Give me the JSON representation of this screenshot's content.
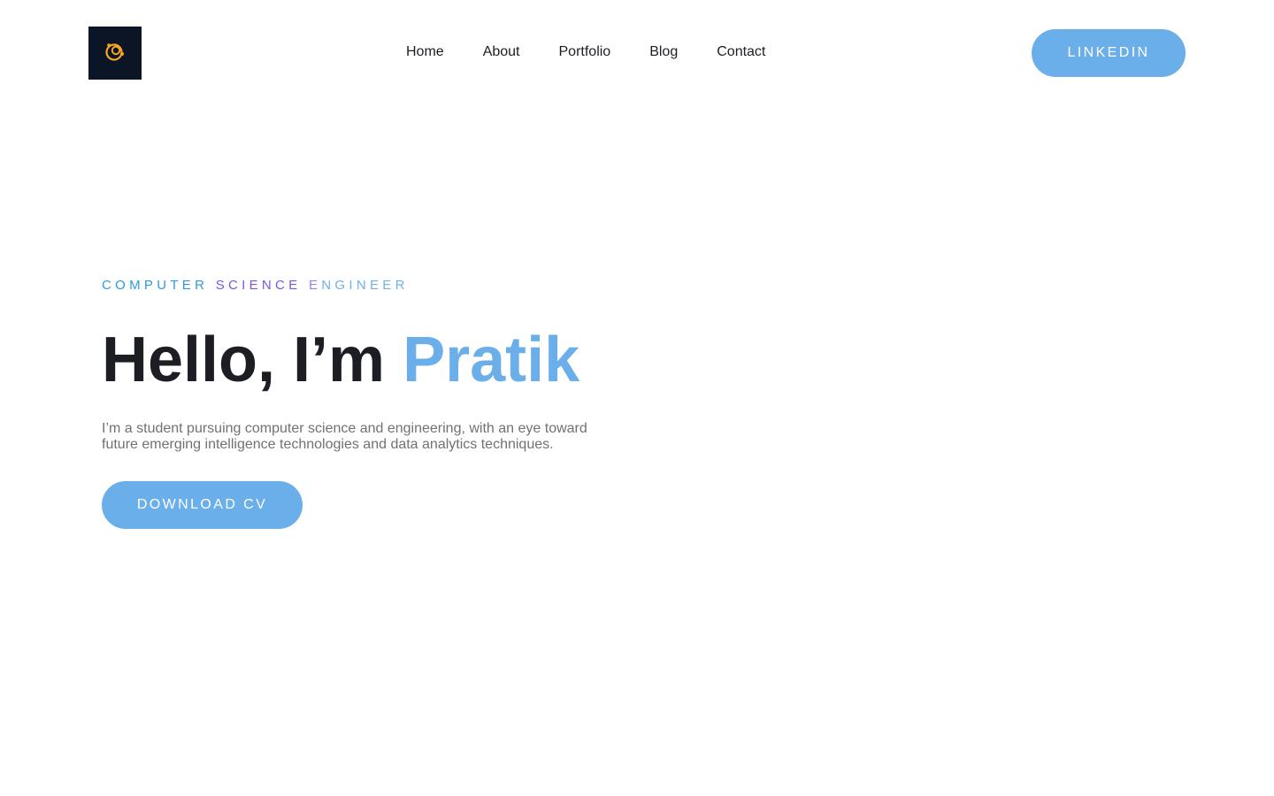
{
  "header": {
    "logo_icon": "orbit-logo-icon",
    "brand_colors": {
      "logo_bg": "#0b1526",
      "logo_mark": "#f5a623"
    },
    "nav": [
      {
        "label": "Home"
      },
      {
        "label": "About"
      },
      {
        "label": "Portfolio"
      },
      {
        "label": "Blog"
      },
      {
        "label": "Contact"
      }
    ],
    "linkedin_label": "LINKEDIN"
  },
  "hero": {
    "eyebrow": {
      "word1": "COMPUTER",
      "word2": "SCIENCE",
      "word3_first": "E",
      "word3_rest": "NGINEER"
    },
    "headline_prefix": "Hello, I’m",
    "headline_name": "Pratik",
    "intro_line1": "I’m a student pursuing computer science and engineering, with an eye toward",
    "intro_line2": "future emerging intelligence technologies and data analytics techniques.",
    "cta_label": "DOWNLOAD CV"
  },
  "colors": {
    "accent": "#6aafea",
    "text_dark": "#1d1d24",
    "text_muted": "#717173"
  }
}
